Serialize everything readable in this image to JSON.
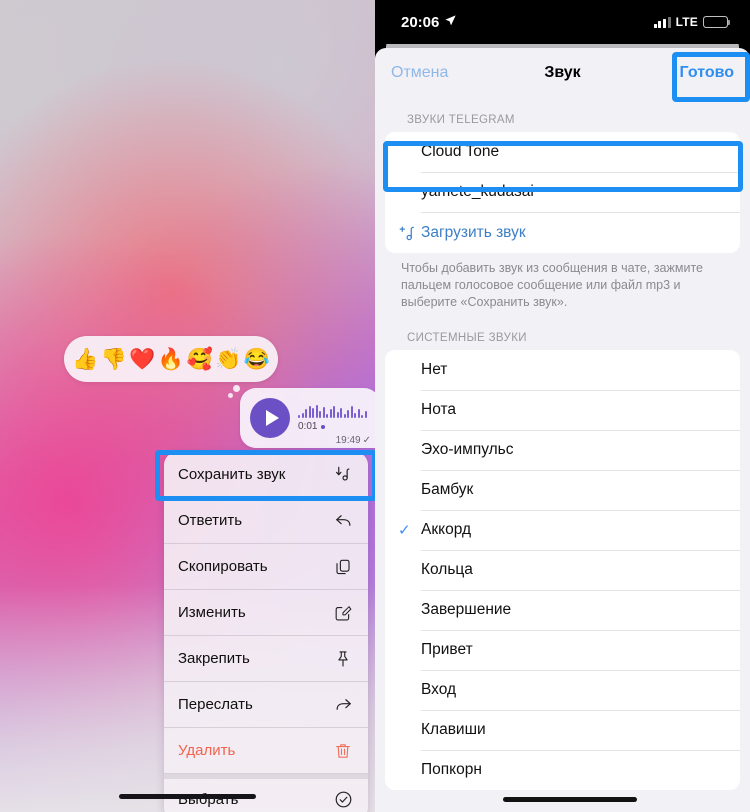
{
  "left": {
    "reactions": [
      {
        "name": "thumbs-up",
        "glyph": "👍"
      },
      {
        "name": "thumbs-down",
        "glyph": "👎"
      },
      {
        "name": "red-heart",
        "glyph": "❤️"
      },
      {
        "name": "fire",
        "glyph": "🔥"
      },
      {
        "name": "smiling-face-with-hearts",
        "glyph": "🥰"
      },
      {
        "name": "clapping-hands",
        "glyph": "👏"
      },
      {
        "name": "face-with-tears-of-joy",
        "glyph": "😂"
      }
    ],
    "voice_message": {
      "duration": "0:01",
      "timestamp": "19:49",
      "status_check": "✓"
    },
    "context_menu": [
      {
        "label": "Сохранить звук",
        "icon": "save-sound-icon",
        "danger": false,
        "highlighted": true
      },
      {
        "label": "Ответить",
        "icon": "reply-icon",
        "danger": false,
        "highlighted": false
      },
      {
        "label": "Скопировать",
        "icon": "copy-icon",
        "danger": false,
        "highlighted": false
      },
      {
        "label": "Изменить",
        "icon": "edit-icon",
        "danger": false,
        "highlighted": false
      },
      {
        "label": "Закрепить",
        "icon": "pin-icon",
        "danger": false,
        "highlighted": false
      },
      {
        "label": "Переслать",
        "icon": "forward-icon",
        "danger": false,
        "highlighted": false
      },
      {
        "label": "Удалить",
        "icon": "trash-icon",
        "danger": true,
        "highlighted": false
      },
      {
        "label": "Выбрать",
        "icon": "select-circle-check-icon",
        "danger": false,
        "highlighted": false
      }
    ]
  },
  "right": {
    "status_bar": {
      "time": "20:06",
      "location_icon": "location-arrow-icon",
      "signal_icon": "cellular-signal-icon",
      "network": "LTE",
      "battery_icon": "battery-icon"
    },
    "nav": {
      "cancel": "Отмена",
      "title": "Звук",
      "done": "Готово"
    },
    "telegram_section": {
      "header": "ЗВУКИ TELEGRAM",
      "items": [
        {
          "label": "Cloud Tone",
          "selected": false,
          "highlighted": true
        },
        {
          "label": "yamete_kudasai",
          "selected": false,
          "highlighted": false
        }
      ],
      "upload": {
        "label": "Загрузить звук",
        "icon": "music-note-plus-icon"
      },
      "helper": "Чтобы добавить звук из сообщения в чате, зажмите пальцем голосовое сообщение или файл mp3 и выберите «Сохранить звук»."
    },
    "system_section": {
      "header": "СИСТЕМНЫЕ ЗВУКИ",
      "items": [
        {
          "label": "Нет",
          "selected": false
        },
        {
          "label": "Нота",
          "selected": false
        },
        {
          "label": "Эхо-импульс",
          "selected": false
        },
        {
          "label": "Бамбук",
          "selected": false
        },
        {
          "label": "Аккорд",
          "selected": true
        },
        {
          "label": "Кольца",
          "selected": false
        },
        {
          "label": "Завершение",
          "selected": false
        },
        {
          "label": "Привет",
          "selected": false
        },
        {
          "label": "Вход",
          "selected": false
        },
        {
          "label": "Клавиши",
          "selected": false
        },
        {
          "label": "Попкорн",
          "selected": false
        }
      ],
      "checkmark": "✓"
    }
  },
  "colors": {
    "highlight_blue": "#1d8ff2",
    "link_blue": "#2f8ff0",
    "danger_red": "#f0644f",
    "check_blue": "#3d8ff5"
  }
}
